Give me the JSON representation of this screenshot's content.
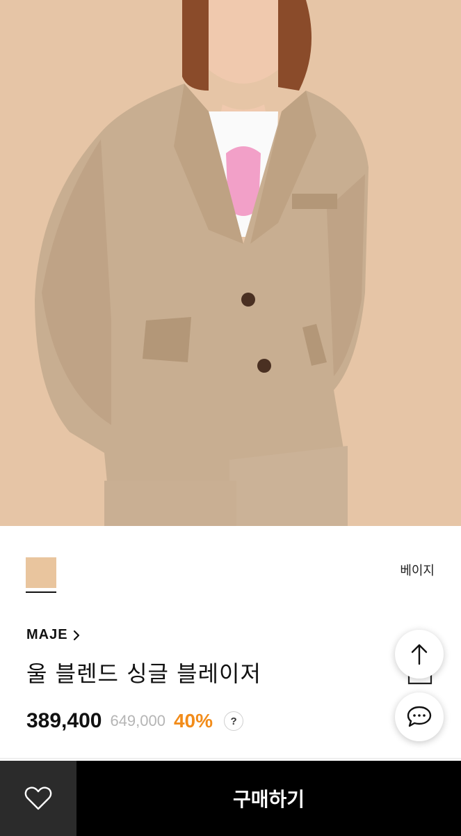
{
  "product": {
    "color_name": "베이지",
    "swatch_color": "#e9c59e",
    "brand": "MAJE",
    "title": "울 블렌드 싱글 블레이저",
    "price": "389,400",
    "original_price": "649,000",
    "discount": "40%",
    "help_symbol": "?"
  },
  "actions": {
    "buy_label": "구매하기"
  },
  "icons": {
    "scroll_top": "arrow-up-icon",
    "chat": "chat-bubble-icon",
    "wishlist": "heart-icon",
    "share": "share-icon",
    "brand_link": "chevron-right-icon"
  },
  "colors": {
    "accent_discount": "#f28c1a",
    "buy_bar": "#000000",
    "wish_bar": "#2b2b2b",
    "hero_background": "#e6c5a6"
  }
}
